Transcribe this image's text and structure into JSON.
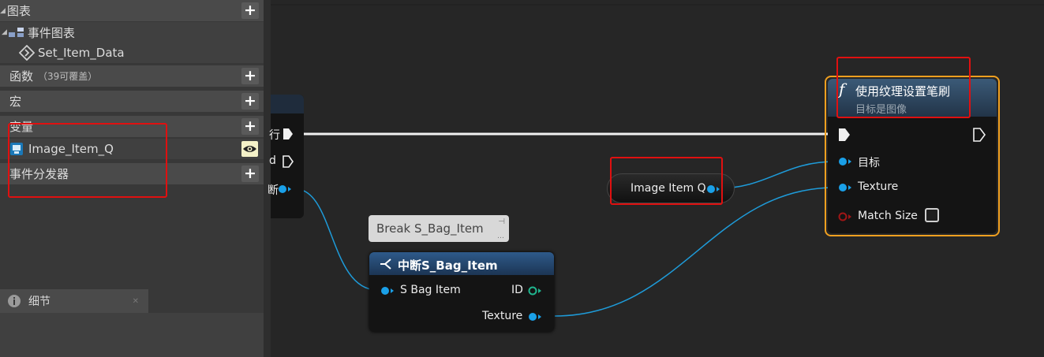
{
  "sidebar": {
    "graphs_label": "图表",
    "event_graph_label": "事件图表",
    "set_item_data_label": "Set_Item_Data",
    "functions_label": "函数",
    "functions_note": "（39可覆盖）",
    "macros_label": "宏",
    "variables_label": "变量",
    "variable_image_item": "Image_Item_Q",
    "dispatchers_label": "事件分发器"
  },
  "details": {
    "tab_label": "细节"
  },
  "nodes": {
    "left_partial": {
      "pin1_label": "行",
      "pin2_label": "d",
      "pin3_label": "断"
    },
    "break_tooltip": "Break S_Bag_Item",
    "break_node": {
      "title": "中断S_Bag_Item",
      "input_label": "S Bag Item",
      "output_id": "ID",
      "output_texture": "Texture"
    },
    "var_node": {
      "label": "Image Item Q"
    },
    "func_node": {
      "title": "使用纹理设置笔刷",
      "subtitle": "目标是图像",
      "pin_target": "目标",
      "pin_texture": "Texture",
      "pin_match_size": "Match Size"
    }
  },
  "colors": {
    "exec_wire": "#f0f0f0",
    "data_wire": "#1e9bd9",
    "pin_blue": "#1aa0e8",
    "pin_green": "#20b58e",
    "pin_red": "#a01616",
    "node_highlight": "#f0a020",
    "annotation_red": "#e01010"
  }
}
